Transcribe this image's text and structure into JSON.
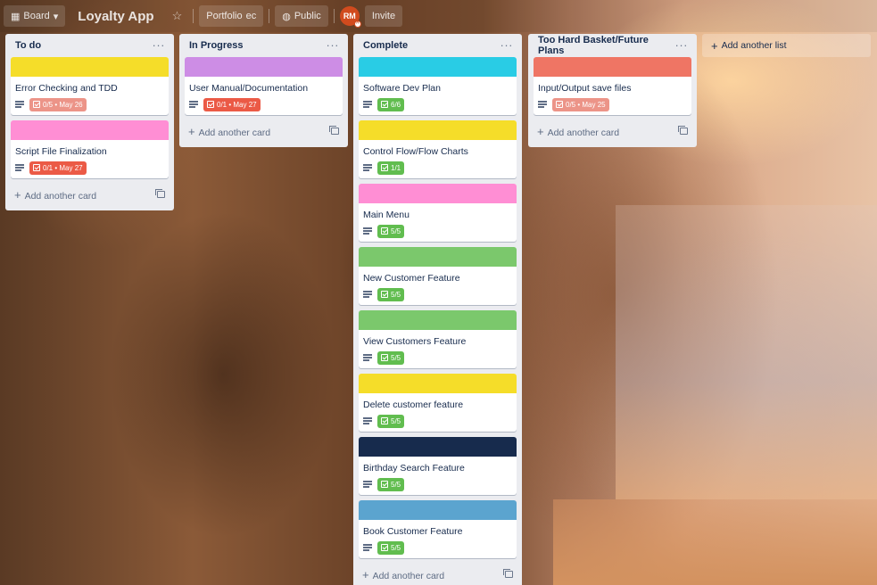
{
  "header": {
    "board_view_label": "Board",
    "board_title": "Loyalty App",
    "workspace_label": "Portfolio",
    "workspace_suffix": "ec",
    "visibility_label": "Public",
    "avatar_initials": "RM",
    "invite_label": "Invite"
  },
  "lists": [
    {
      "title": "To do",
      "cards": [
        {
          "cover": "#f5dd29",
          "title": "Error Checking and TDD",
          "badge": "0/5 • May 26",
          "badge_style": "lightred"
        },
        {
          "cover": "#ff8ed4",
          "title": "Script File Finalization",
          "badge": "0/1 • May 27",
          "badge_style": "red"
        }
      ],
      "add_card_label": "Add another card"
    },
    {
      "title": "In Progress",
      "cards": [
        {
          "cover": "#cd8de5",
          "title": "User Manual/Documentation",
          "badge": "0/1 • May 27",
          "badge_style": "red"
        }
      ],
      "add_card_label": "Add another card"
    },
    {
      "title": "Complete",
      "cards": [
        {
          "cover": "#29cce5",
          "title": "Software Dev Plan",
          "badge": "6/6",
          "badge_style": "green"
        },
        {
          "cover": "#f5dd29",
          "title": "Control Flow/Flow Charts",
          "badge": "1/1",
          "badge_style": "green"
        },
        {
          "cover": "#ff8ed4",
          "title": "Main Menu",
          "badge": "5/5",
          "badge_style": "green"
        },
        {
          "cover": "#7bc86c",
          "title": "New Customer Feature",
          "badge": "5/5",
          "badge_style": "green"
        },
        {
          "cover": "#7bc86c",
          "title": "View Customers Feature",
          "badge": "5/5",
          "badge_style": "green"
        },
        {
          "cover": "#f5dd29",
          "title": "Delete customer feature",
          "badge": "5/5",
          "badge_style": "green"
        },
        {
          "cover": "#172b4d",
          "title": "Birthday Search Feature",
          "badge": "5/5",
          "badge_style": "green"
        },
        {
          "cover": "#5ba4cf",
          "title": "Book Customer Feature",
          "badge": "5/5",
          "badge_style": "green"
        }
      ],
      "add_card_label": "Add another card"
    },
    {
      "title": "Too Hard Basket/Future Plans",
      "cards": [
        {
          "cover": "#ef7564",
          "title": "Input/Output save files",
          "badge": "0/5 • May 25",
          "badge_style": "lightred"
        }
      ],
      "add_card_label": "Add another card"
    }
  ],
  "add_list_label": "Add another list",
  "icons": {
    "list_menu": "ellipsis-icon",
    "description": "description-icon",
    "checklist": "checklist-icon",
    "template": "card-template-icon"
  }
}
